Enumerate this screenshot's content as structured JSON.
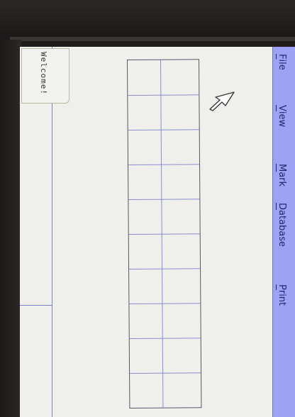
{
  "welcome": {
    "text": "Welcome!"
  },
  "menu": {
    "items": [
      {
        "label": "File",
        "icon": ""
      },
      {
        "label": "View"
      },
      {
        "label": "Mark"
      },
      {
        "label": "Database"
      },
      {
        "label": "Print"
      }
    ]
  },
  "cursor": {
    "icon": "arrow-cursor-icon"
  },
  "colors": {
    "screen_bg": "#efefec",
    "menubar_bg": "#9ea2f4",
    "grid_line": "#8b8ed0"
  }
}
